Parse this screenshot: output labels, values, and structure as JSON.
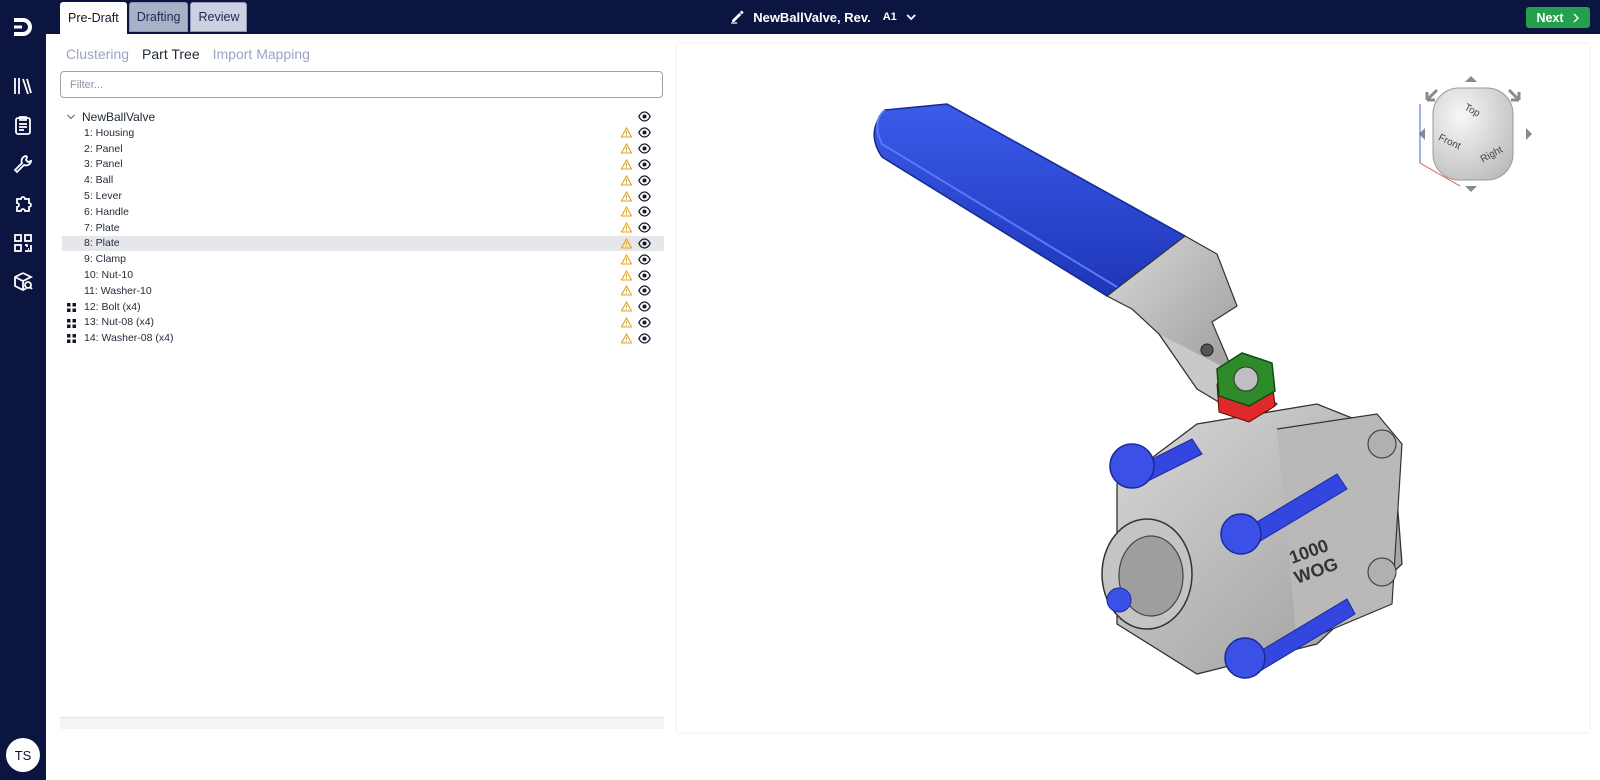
{
  "header": {
    "stages": [
      "Pre-Draft",
      "Drafting",
      "Review"
    ],
    "doc_name": "NewBallValve, Rev.",
    "revision": "A1",
    "next_label": "Next"
  },
  "user": {
    "initials": "TS"
  },
  "panel": {
    "tabs": [
      "Clustering",
      "Part Tree",
      "Import Mapping"
    ],
    "active_tab": "Part Tree",
    "filter_placeholder": "Filter..."
  },
  "tree": {
    "root": "NewBallValve",
    "items": [
      {
        "label": "1: Housing",
        "group": false,
        "selected": false
      },
      {
        "label": "2: Panel",
        "group": false,
        "selected": false
      },
      {
        "label": "3: Panel",
        "group": false,
        "selected": false
      },
      {
        "label": "4: Ball",
        "group": false,
        "selected": false
      },
      {
        "label": "5: Lever",
        "group": false,
        "selected": false
      },
      {
        "label": "6: Handle",
        "group": false,
        "selected": false
      },
      {
        "label": "7: Plate",
        "group": false,
        "selected": false
      },
      {
        "label": "8: Plate",
        "group": false,
        "selected": true
      },
      {
        "label": "9: Clamp",
        "group": false,
        "selected": false
      },
      {
        "label": "10: Nut-10",
        "group": false,
        "selected": false
      },
      {
        "label": "11: Washer-10",
        "group": false,
        "selected": false
      },
      {
        "label": "12: Bolt (x4)",
        "group": true,
        "selected": false
      },
      {
        "label": "13: Nut-08 (x4)",
        "group": true,
        "selected": false
      },
      {
        "label": "14: Washer-08 (x4)",
        "group": true,
        "selected": false
      }
    ]
  },
  "viewcube": {
    "faces": [
      "Top",
      "Front",
      "Right"
    ]
  },
  "model": {
    "marking_line1": "1000",
    "marking_line2": "WOG"
  },
  "colors": {
    "nav_bg": "#0c1540",
    "accent_green": "#22a04b",
    "handle_blue": "#2f49d8",
    "nut_green": "#2f8a2a",
    "warning": "#e5a01c"
  },
  "icons": [
    "logo-icon",
    "library-icon",
    "clipboard-icon",
    "wrench-icon",
    "puzzle-icon",
    "qr-icon",
    "package-search-icon",
    "pencil-icon",
    "chevron-down-icon",
    "chevron-right-icon",
    "warning-icon",
    "eye-icon",
    "group-icon"
  ]
}
